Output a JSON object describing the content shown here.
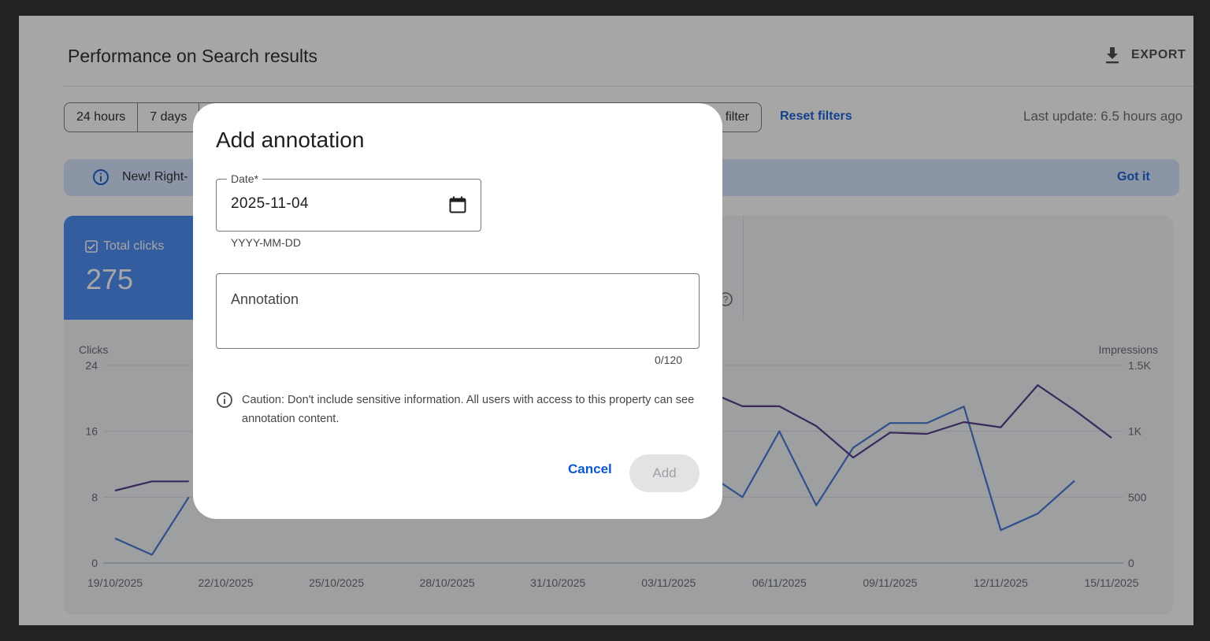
{
  "header": {
    "title": "Performance on Search results",
    "export_label": "EXPORT"
  },
  "filters": {
    "chips": [
      "24 hours",
      "7 days",
      "filter"
    ],
    "reset_label": "Reset filters",
    "last_update": "Last update: 6.5 hours ago"
  },
  "banner": {
    "text": "New! Right-",
    "action": "Got it"
  },
  "metric": {
    "label": "Total clicks",
    "value": "275"
  },
  "chart_data": {
    "type": "line",
    "x": [
      "19/10/2025",
      "20/10/2025",
      "21/10/2025",
      "22/10/2025",
      "23/10/2025",
      "24/10/2025",
      "25/10/2025",
      "26/10/2025",
      "27/10/2025",
      "28/10/2025",
      "29/10/2025",
      "30/10/2025",
      "31/10/2025",
      "01/11/2025",
      "02/11/2025",
      "03/11/2025",
      "04/11/2025",
      "05/11/2025",
      "06/11/2025",
      "07/11/2025",
      "08/11/2025",
      "09/11/2025",
      "10/11/2025",
      "11/11/2025",
      "12/11/2025",
      "13/11/2025",
      "14/11/2025",
      "15/11/2025"
    ],
    "x_tick_labels": [
      "19/10/2025",
      "22/10/2025",
      "25/10/2025",
      "28/10/2025",
      "31/10/2025",
      "03/11/2025",
      "06/11/2025",
      "09/11/2025",
      "12/11/2025",
      "15/11/2025"
    ],
    "xlabel": "",
    "ylabel_left": "Clicks",
    "ylabel_right": "Impressions",
    "ylim_left": [
      0,
      24
    ],
    "ylim_right": [
      0,
      1500
    ],
    "yticks_left": [
      "0",
      "8",
      "16",
      "24"
    ],
    "yticks_right": [
      "0",
      "500",
      "1K",
      "1.5K"
    ],
    "series": [
      {
        "name": "Clicks",
        "axis": "left",
        "color": "#3c6fd0",
        "values": [
          3,
          1,
          8,
          null,
          null,
          5,
          null,
          null,
          null,
          null,
          null,
          null,
          null,
          null,
          5,
          null,
          11,
          8,
          16,
          7,
          14,
          17,
          17,
          19,
          4,
          6,
          10,
          null
        ],
        "visible_range": [
          0,
          27
        ]
      },
      {
        "name": "Impressions",
        "axis": "right",
        "color": "#4b2e83",
        "values": [
          550,
          620,
          620,
          null,
          null,
          null,
          null,
          null,
          null,
          null,
          null,
          null,
          null,
          null,
          null,
          null,
          1310,
          1190,
          1190,
          1040,
          800,
          990,
          980,
          1070,
          1030,
          1350,
          1160,
          950
        ]
      }
    ],
    "grid": true,
    "legend": "none"
  },
  "dialog": {
    "title": "Add annotation",
    "date_label": "Date*",
    "date_value": "2025-11-04",
    "date_hint": "YYYY-MM-DD",
    "annotation_placeholder": "Annotation",
    "counter": "0/120",
    "caution": "Caution: Don't include sensitive information. All users with access to this property can see annotation content.",
    "cancel_label": "Cancel",
    "add_label": "Add"
  },
  "colors": {
    "accent": "#0b57d0",
    "metric_bg": "#4285f4",
    "banner_bg": "#d3e3fd"
  },
  "icons": [
    "download-icon",
    "info-icon",
    "checkbox-icon",
    "help-icon",
    "calendar-icon"
  ]
}
